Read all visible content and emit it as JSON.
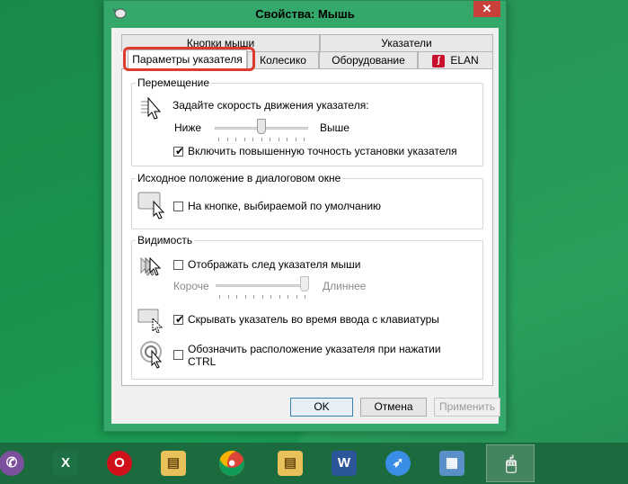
{
  "window": {
    "title": "Свойства: Мышь",
    "close_label": "✕"
  },
  "tabs": {
    "row1": [
      {
        "label": "Кнопки мыши"
      },
      {
        "label": "Указатели"
      }
    ],
    "row2": [
      {
        "label": "Параметры указателя",
        "active": true
      },
      {
        "label": "Колесико"
      },
      {
        "label": "Оборудование"
      },
      {
        "label": "ELAN"
      }
    ]
  },
  "motion": {
    "legend": "Перемещение",
    "description": "Задайте скорость движения указателя:",
    "slow_label": "Ниже",
    "fast_label": "Выше",
    "speed_level": 0.5,
    "precision_label": "Включить повышенную точность установки указателя",
    "precision_checked": true
  },
  "snap_to": {
    "legend": "Исходное положение в диалоговом окне",
    "option_label": "На кнопке, выбираемой по умолчанию",
    "checked": false
  },
  "visibility": {
    "legend": "Видимость",
    "trails_label": "Отображать след указателя мыши",
    "trails_checked": false,
    "short_label": "Короче",
    "long_label": "Длиннее",
    "trail_level": 1.0,
    "hide_typing_label": "Скрывать указатель во время ввода с клавиатуры",
    "hide_typing_checked": true,
    "ctrl_label_line1": "Обозначить расположение указателя при нажатии",
    "ctrl_label_line2": "CTRL",
    "ctrl_checked": false
  },
  "buttons": {
    "ok": "OK",
    "cancel": "Отмена",
    "apply": "Применить"
  },
  "taskbar": {
    "items": [
      {
        "icon": "viber-icon"
      },
      {
        "icon": "excel-icon"
      },
      {
        "icon": "opera-icon"
      },
      {
        "icon": "file-explorer-icon"
      },
      {
        "icon": "chrome-icon"
      },
      {
        "icon": "file-explorer-icon"
      },
      {
        "icon": "word-icon"
      },
      {
        "icon": "app-bird-icon"
      },
      {
        "icon": "control-panel-icon"
      },
      {
        "icon": "mouse-properties-icon",
        "active": true
      }
    ]
  },
  "colors": {
    "desktop": "#1a8a4a",
    "window_frame": "#33a86a",
    "highlight": "#e03a2e"
  }
}
